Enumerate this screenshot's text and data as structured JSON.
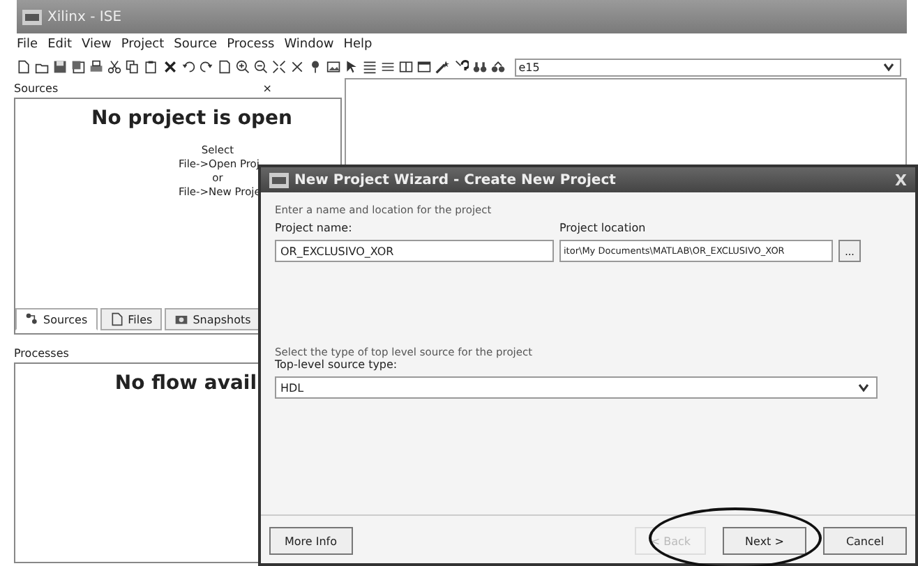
{
  "window": {
    "title": "Xilinx - ISE"
  },
  "menu": [
    "File",
    "Edit",
    "View",
    "Project",
    "Source",
    "Process",
    "Window",
    "Help"
  ],
  "toolbar": {
    "combo_value": "e15"
  },
  "sources_panel": {
    "title": "Sources",
    "close": "×",
    "heading": "No project is open",
    "hint_lines": [
      "Select",
      "File->Open Proj",
      "or",
      "File->New Proje"
    ],
    "tabs": [
      {
        "label": "Sources",
        "selected": true
      },
      {
        "label": "Files",
        "selected": false
      },
      {
        "label": "Snapshots",
        "selected": false
      }
    ]
  },
  "processes_panel": {
    "title": "Processes",
    "heading": "No flow avail"
  },
  "dialog": {
    "title": "New Project Wizard - Create New Project",
    "close": "X",
    "intro": "Enter a name and location for the project",
    "name_label": "Project name:",
    "name_value": "OR_EXCLUSIVO_XOR",
    "location_label": "Project location",
    "location_value": "itor\\My Documents\\MATLAB\\OR_EXCLUSIVO_XOR",
    "browse": "...",
    "type_intro": "Select the type of top level source for the project",
    "type_label": "Top-level source type:",
    "type_value": "HDL",
    "buttons": [
      {
        "label": "More Info",
        "disabled": false
      },
      {
        "label": "< Back",
        "disabled": true
      },
      {
        "label": "Next >",
        "disabled": false
      },
      {
        "label": "Cancel",
        "disabled": false
      }
    ]
  }
}
